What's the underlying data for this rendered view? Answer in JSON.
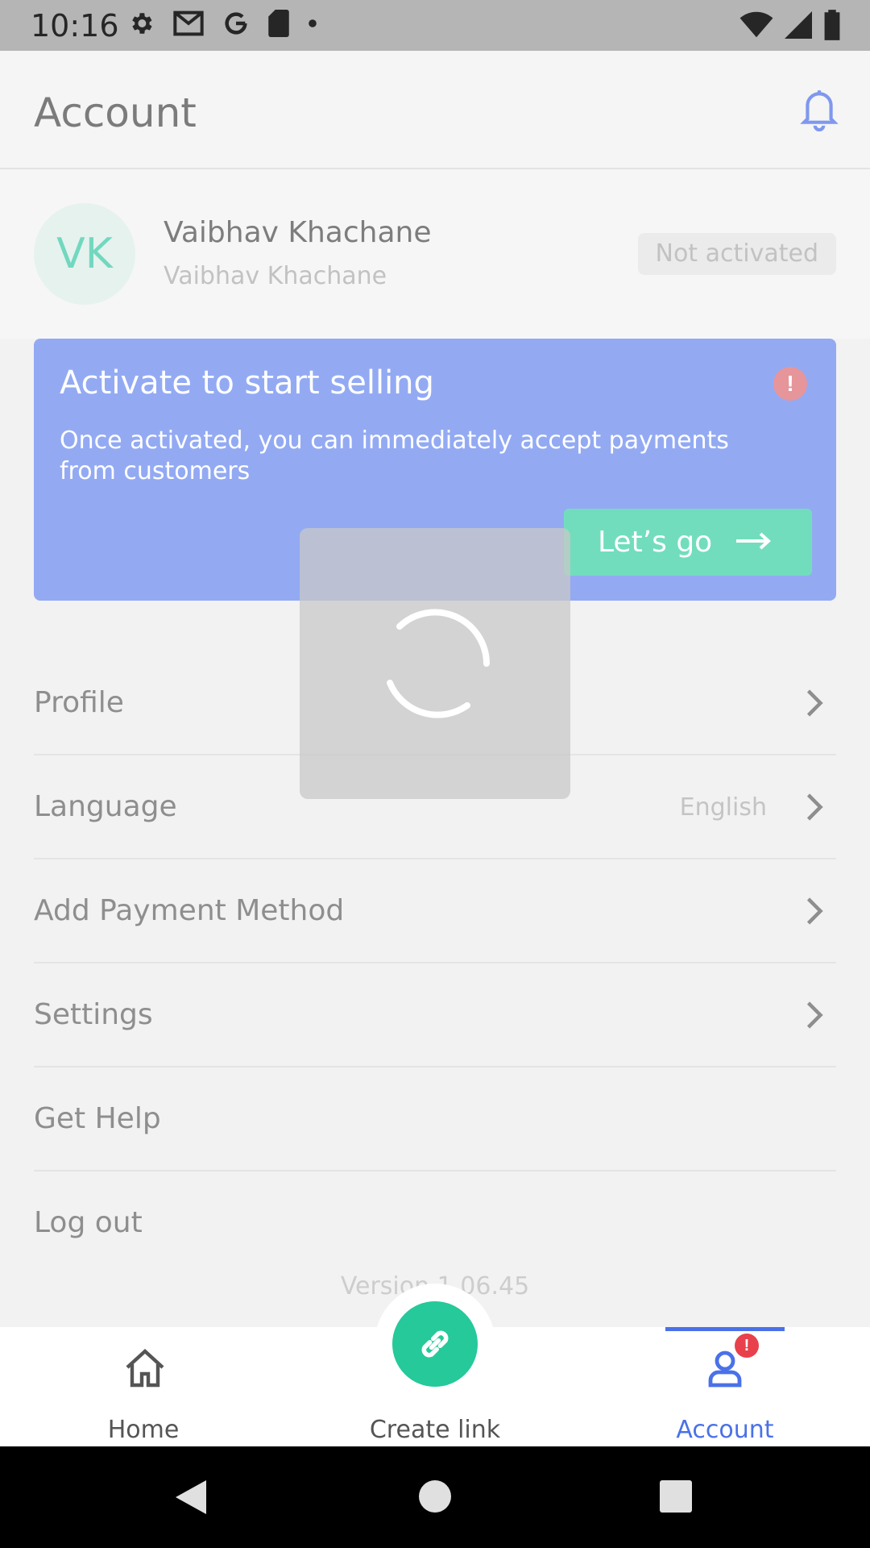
{
  "status_bar": {
    "time": "10:16",
    "left_icons": [
      "settings-gear-icon",
      "gmail-icon",
      "google-icon",
      "sd-card-icon",
      "dot-icon"
    ],
    "right_icons": [
      "wifi-icon",
      "signal-icon",
      "battery-icon"
    ]
  },
  "header": {
    "title": "Account",
    "notification_icon": "bell-icon"
  },
  "profile": {
    "initials": "VK",
    "name": "Vaibhav Khachane",
    "subtitle": "Vaibhav Khachane",
    "status": "Not activated"
  },
  "activate_card": {
    "title": "Activate to start selling",
    "alert_symbol": "!",
    "description": "Once activated, you can immediately accept payments from customers",
    "button_label": "Let’s go",
    "background": "#93aaf3",
    "button_color": "#72ddbd"
  },
  "menu": {
    "items": [
      {
        "label": "Profile",
        "value": "",
        "has_chevron": true
      },
      {
        "label": "Language",
        "value": "English",
        "has_chevron": true
      },
      {
        "label": "Add Payment Method",
        "value": "",
        "has_chevron": true
      },
      {
        "label": "Settings",
        "value": "",
        "has_chevron": true
      },
      {
        "label": "Get Help",
        "value": "",
        "has_chevron": false
      },
      {
        "label": "Log out",
        "value": "",
        "has_chevron": false
      }
    ]
  },
  "version": "Version 1.06.45",
  "loading_overlay": {
    "visible": true
  },
  "bottom_nav": {
    "home_label": "Home",
    "create_label": "Create link",
    "account_label": "Account",
    "account_badge": "!",
    "active_tab": "Account",
    "accent": "#4a71e8",
    "fab_color": "#25c99a"
  },
  "system_nav": {
    "buttons": [
      "back-icon",
      "home-circle-icon",
      "recents-square-icon"
    ]
  }
}
